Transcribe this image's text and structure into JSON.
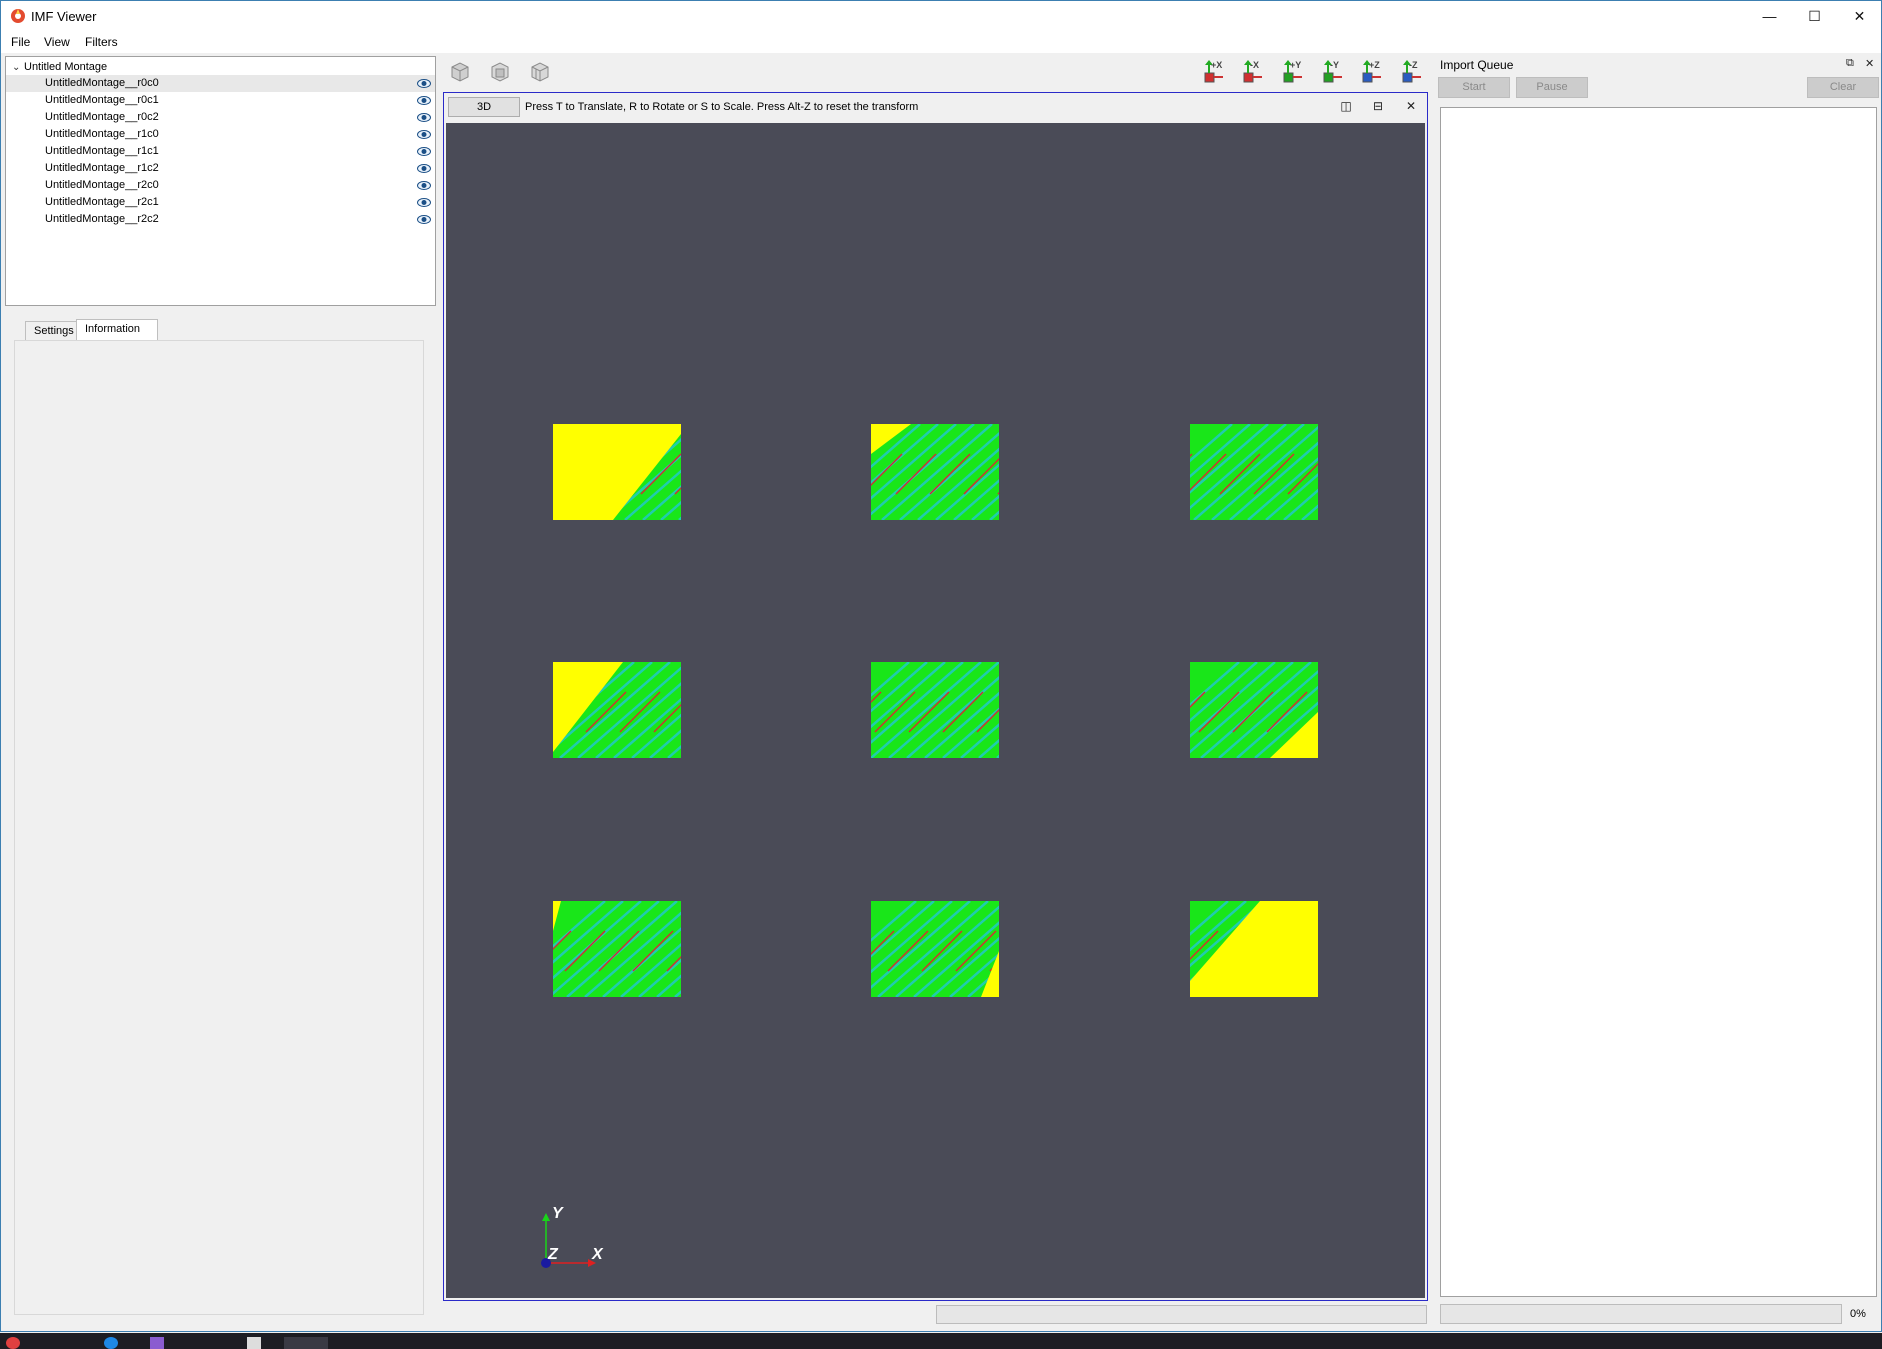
{
  "app": {
    "title": "IMF Viewer"
  },
  "window_controls": {
    "minimize": "—",
    "maximize": "☐",
    "close": "✕"
  },
  "menu": {
    "file": "File",
    "view": "View",
    "filters": "Filters"
  },
  "tree": {
    "root": "Untitled Montage",
    "items": [
      "UntitledMontage__r0c0",
      "UntitledMontage__r0c1",
      "UntitledMontage__r0c2",
      "UntitledMontage__r1c0",
      "UntitledMontage__r1c1",
      "UntitledMontage__r1c2",
      "UntitledMontage__r2c0",
      "UntitledMontage__r2c1",
      "UntitledMontage__r2c2"
    ]
  },
  "tabs": {
    "settings": "Settings",
    "information": "Information",
    "active": "Information"
  },
  "toolbar": {
    "view_icons": [
      "cube-view-icon",
      "cube-front-icon",
      "cube-iso-icon"
    ],
    "axis_buttons": [
      "+X",
      "-X",
      "+Y",
      "-Y",
      "+Z",
      "-Z"
    ]
  },
  "viewport": {
    "mode_button": "3D",
    "hint": "Press T to Translate, R to Rotate or S to Scale. Press Alt-Z to reset the transform",
    "background_color": "#4a4b57",
    "axes": {
      "x": "X",
      "y": "Y",
      "z": "Z"
    }
  },
  "import_queue": {
    "title": "Import Queue",
    "start": "Start",
    "pause": "Pause",
    "clear": "Clear",
    "progress_percent": "0%"
  },
  "colors": {
    "viewport_border": "#2a2ac8",
    "tile_yellow": "#ffff00",
    "tile_green": "#19e619",
    "tile_cyan": "#22c8c8",
    "tile_red": "#d03030"
  }
}
